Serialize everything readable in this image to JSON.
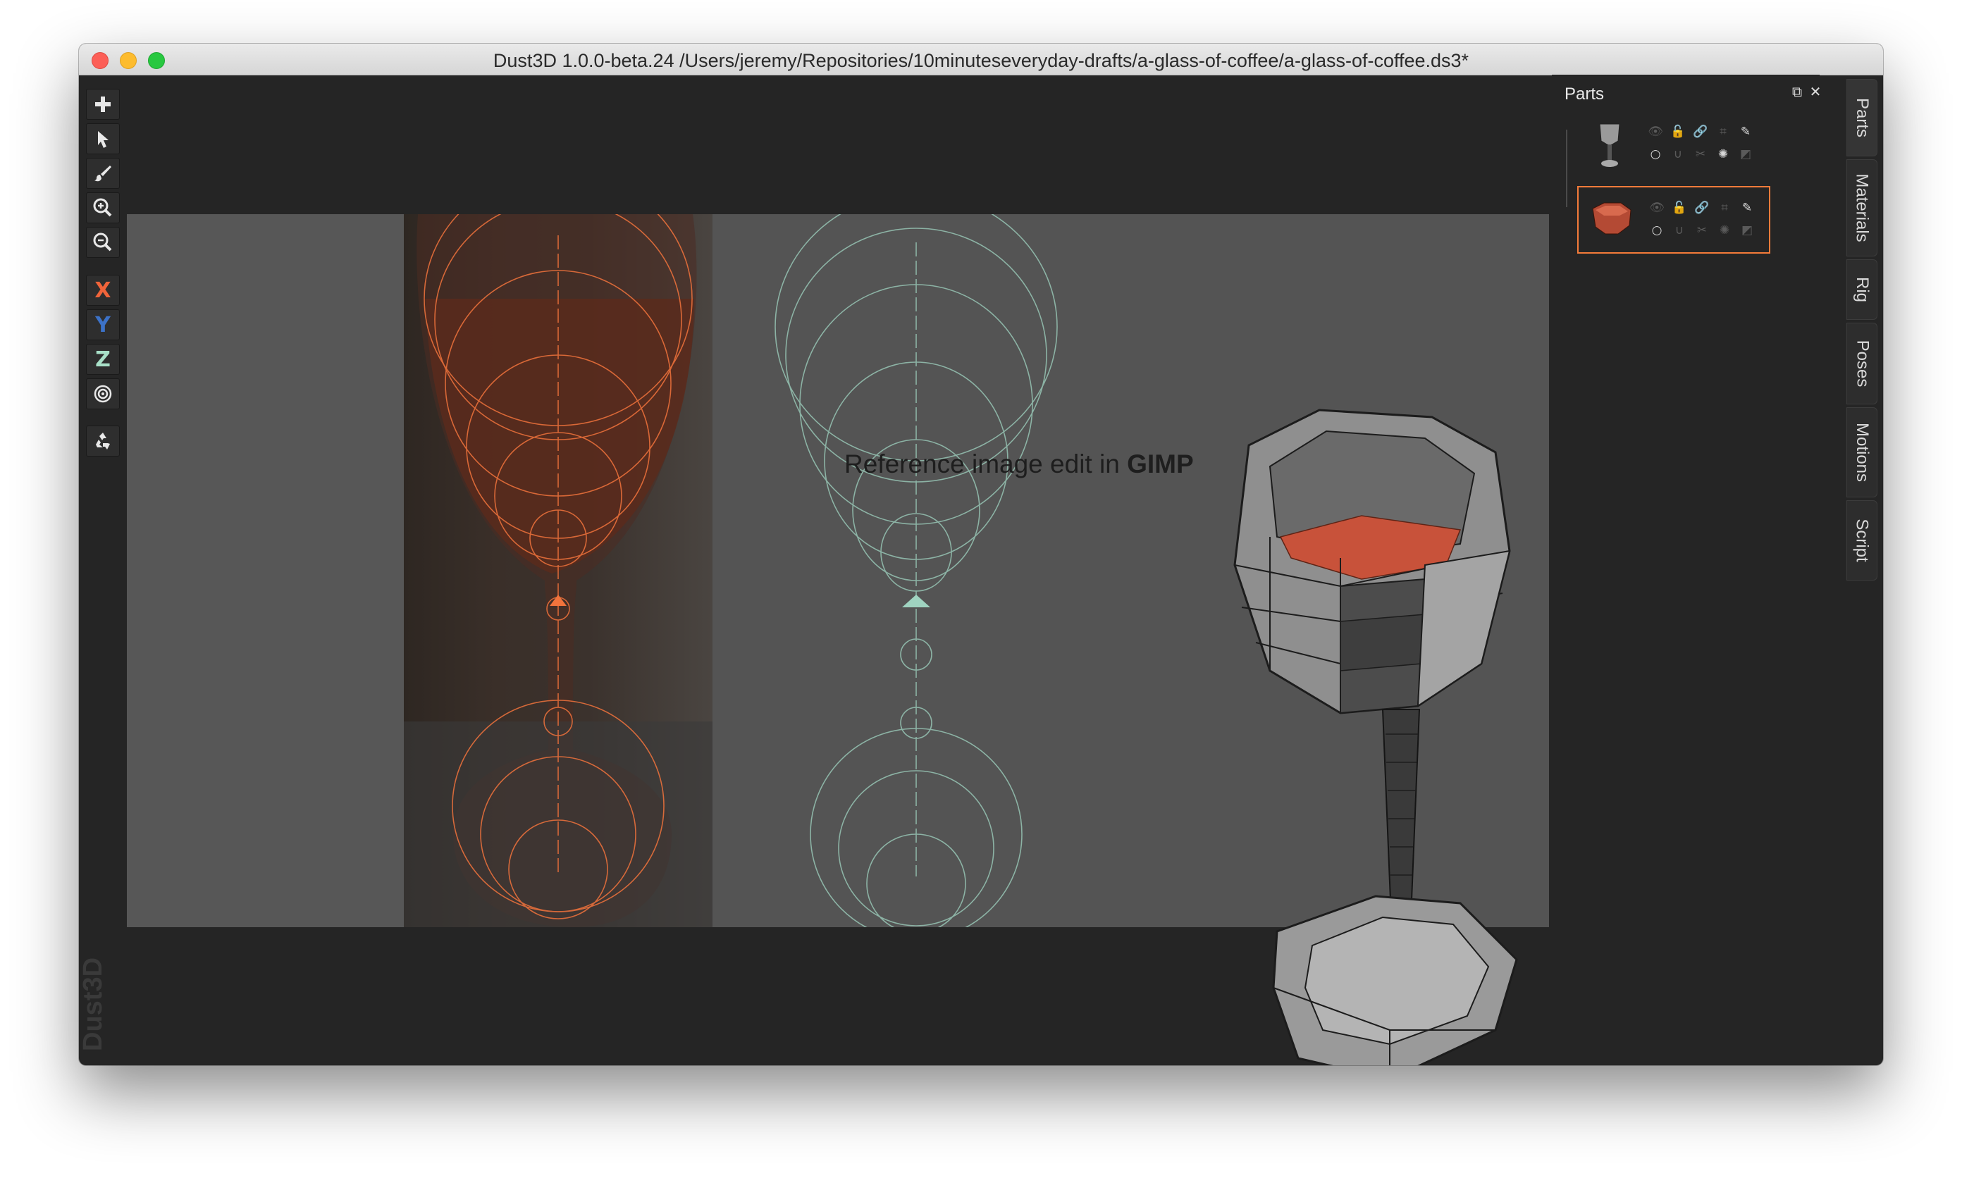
{
  "window": {
    "title": "Dust3D 1.0.0-beta.24 /Users/jeremy/Repositories/10minuteseveryday-drafts/a-glass-of-coffee/a-glass-of-coffee.ds3*"
  },
  "toolbar": {
    "tools": [
      {
        "name": "add-icon",
        "active": false
      },
      {
        "name": "select-icon",
        "active": false
      },
      {
        "name": "paint-brush-icon",
        "active": false
      },
      {
        "name": "zoom-in-icon",
        "active": false
      },
      {
        "name": "zoom-out-icon",
        "active": false
      }
    ],
    "axes": [
      {
        "label": "X",
        "color": "#f0643a"
      },
      {
        "label": "Y",
        "color": "#3c72c8"
      },
      {
        "label": "Z",
        "color": "#a8e0c8"
      }
    ],
    "extras": [
      "radius-icon",
      "recycle-icon"
    ]
  },
  "canvas": {
    "reference_label_prefix": "Reference image edit in ",
    "reference_label_bold": "GIMP",
    "colors": {
      "front_view_wire": "#f1733c",
      "side_view_wire": "#9fd3c0",
      "model_body": "#9a9a9a",
      "model_liquid": "#c8523a"
    }
  },
  "logo": {
    "text": "Dust3D"
  },
  "parts_panel": {
    "title": "Parts",
    "parts": [
      {
        "name": "glass",
        "selected": false
      },
      {
        "name": "coffee",
        "selected": true
      }
    ],
    "selection_color": "#f47b3a"
  },
  "side_tabs": [
    {
      "label": "Parts",
      "active": true
    },
    {
      "label": "Materials",
      "active": false
    },
    {
      "label": "Rig",
      "active": false
    },
    {
      "label": "Poses",
      "active": false
    },
    {
      "label": "Motions",
      "active": false
    },
    {
      "label": "Script",
      "active": false
    }
  ]
}
